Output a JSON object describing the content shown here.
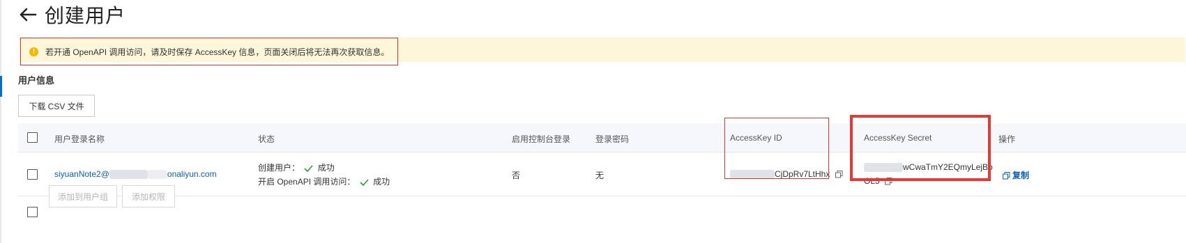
{
  "header": {
    "title": "创建用户"
  },
  "alert": {
    "text": "若开通 OpenAPI 调用访问，请及时保存 AccessKey 信息，页面关闭后将无法再次获取信息。"
  },
  "section": {
    "title": "用户信息"
  },
  "toolbar": {
    "download_csv_label": "下载 CSV 文件"
  },
  "table": {
    "headers": {
      "username": "用户登录名称",
      "status": "状态",
      "console_login": "启用控制台登录",
      "password": "登录密码",
      "access_key_id": "AccessKey ID",
      "access_key_secret": "AccessKey Secret",
      "actions": "操作"
    },
    "row": {
      "username_prefix": "siyuanNote2@",
      "username_suffix": "onaliyun.com",
      "status_create_label": "创建用户：",
      "status_create_value": "成功",
      "status_openapi_label": "开启 OpenAPI 调用访问：",
      "status_openapi_value": "成功",
      "console_login": "否",
      "password": "无",
      "access_key_id_visible": "CjDpRv7LtHhx",
      "access_key_secret_line1": "wCwaTmY2EQmyLejBb",
      "access_key_secret_line2": "OL5",
      "copy_label": "复制"
    }
  },
  "footer": {
    "add_to_group_label": "添加到用户组",
    "add_permission_label": "添加权限"
  },
  "colors": {
    "alert_bg": "#fdf6d8",
    "highlight_red": "#e53935",
    "link_blue": "#0b5fb5",
    "success_green": "#2e9a43",
    "warning_yellow": "#f5b400"
  }
}
